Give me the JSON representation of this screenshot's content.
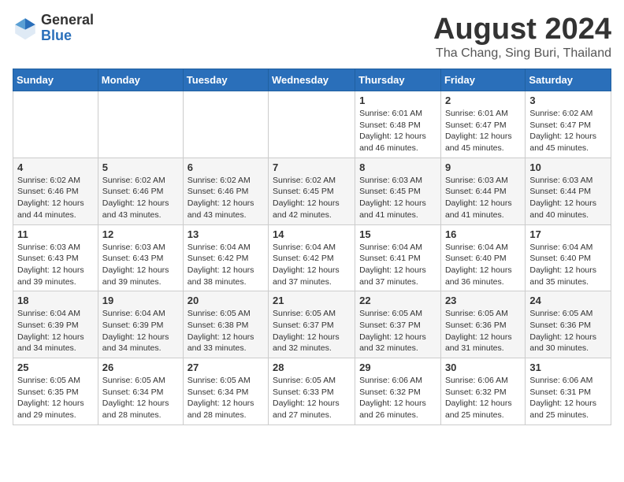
{
  "logo": {
    "general": "General",
    "blue": "Blue"
  },
  "title": "August 2024",
  "location": "Tha Chang, Sing Buri, Thailand",
  "weekdays": [
    "Sunday",
    "Monday",
    "Tuesday",
    "Wednesday",
    "Thursday",
    "Friday",
    "Saturday"
  ],
  "weeks": [
    [
      {
        "day": "",
        "info": ""
      },
      {
        "day": "",
        "info": ""
      },
      {
        "day": "",
        "info": ""
      },
      {
        "day": "",
        "info": ""
      },
      {
        "day": "1",
        "info": "Sunrise: 6:01 AM\nSunset: 6:48 PM\nDaylight: 12 hours\nand 46 minutes."
      },
      {
        "day": "2",
        "info": "Sunrise: 6:01 AM\nSunset: 6:47 PM\nDaylight: 12 hours\nand 45 minutes."
      },
      {
        "day": "3",
        "info": "Sunrise: 6:02 AM\nSunset: 6:47 PM\nDaylight: 12 hours\nand 45 minutes."
      }
    ],
    [
      {
        "day": "4",
        "info": "Sunrise: 6:02 AM\nSunset: 6:46 PM\nDaylight: 12 hours\nand 44 minutes."
      },
      {
        "day": "5",
        "info": "Sunrise: 6:02 AM\nSunset: 6:46 PM\nDaylight: 12 hours\nand 43 minutes."
      },
      {
        "day": "6",
        "info": "Sunrise: 6:02 AM\nSunset: 6:46 PM\nDaylight: 12 hours\nand 43 minutes."
      },
      {
        "day": "7",
        "info": "Sunrise: 6:02 AM\nSunset: 6:45 PM\nDaylight: 12 hours\nand 42 minutes."
      },
      {
        "day": "8",
        "info": "Sunrise: 6:03 AM\nSunset: 6:45 PM\nDaylight: 12 hours\nand 41 minutes."
      },
      {
        "day": "9",
        "info": "Sunrise: 6:03 AM\nSunset: 6:44 PM\nDaylight: 12 hours\nand 41 minutes."
      },
      {
        "day": "10",
        "info": "Sunrise: 6:03 AM\nSunset: 6:44 PM\nDaylight: 12 hours\nand 40 minutes."
      }
    ],
    [
      {
        "day": "11",
        "info": "Sunrise: 6:03 AM\nSunset: 6:43 PM\nDaylight: 12 hours\nand 39 minutes."
      },
      {
        "day": "12",
        "info": "Sunrise: 6:03 AM\nSunset: 6:43 PM\nDaylight: 12 hours\nand 39 minutes."
      },
      {
        "day": "13",
        "info": "Sunrise: 6:04 AM\nSunset: 6:42 PM\nDaylight: 12 hours\nand 38 minutes."
      },
      {
        "day": "14",
        "info": "Sunrise: 6:04 AM\nSunset: 6:42 PM\nDaylight: 12 hours\nand 37 minutes."
      },
      {
        "day": "15",
        "info": "Sunrise: 6:04 AM\nSunset: 6:41 PM\nDaylight: 12 hours\nand 37 minutes."
      },
      {
        "day": "16",
        "info": "Sunrise: 6:04 AM\nSunset: 6:40 PM\nDaylight: 12 hours\nand 36 minutes."
      },
      {
        "day": "17",
        "info": "Sunrise: 6:04 AM\nSunset: 6:40 PM\nDaylight: 12 hours\nand 35 minutes."
      }
    ],
    [
      {
        "day": "18",
        "info": "Sunrise: 6:04 AM\nSunset: 6:39 PM\nDaylight: 12 hours\nand 34 minutes."
      },
      {
        "day": "19",
        "info": "Sunrise: 6:04 AM\nSunset: 6:39 PM\nDaylight: 12 hours\nand 34 minutes."
      },
      {
        "day": "20",
        "info": "Sunrise: 6:05 AM\nSunset: 6:38 PM\nDaylight: 12 hours\nand 33 minutes."
      },
      {
        "day": "21",
        "info": "Sunrise: 6:05 AM\nSunset: 6:37 PM\nDaylight: 12 hours\nand 32 minutes."
      },
      {
        "day": "22",
        "info": "Sunrise: 6:05 AM\nSunset: 6:37 PM\nDaylight: 12 hours\nand 32 minutes."
      },
      {
        "day": "23",
        "info": "Sunrise: 6:05 AM\nSunset: 6:36 PM\nDaylight: 12 hours\nand 31 minutes."
      },
      {
        "day": "24",
        "info": "Sunrise: 6:05 AM\nSunset: 6:36 PM\nDaylight: 12 hours\nand 30 minutes."
      }
    ],
    [
      {
        "day": "25",
        "info": "Sunrise: 6:05 AM\nSunset: 6:35 PM\nDaylight: 12 hours\nand 29 minutes."
      },
      {
        "day": "26",
        "info": "Sunrise: 6:05 AM\nSunset: 6:34 PM\nDaylight: 12 hours\nand 28 minutes."
      },
      {
        "day": "27",
        "info": "Sunrise: 6:05 AM\nSunset: 6:34 PM\nDaylight: 12 hours\nand 28 minutes."
      },
      {
        "day": "28",
        "info": "Sunrise: 6:05 AM\nSunset: 6:33 PM\nDaylight: 12 hours\nand 27 minutes."
      },
      {
        "day": "29",
        "info": "Sunrise: 6:06 AM\nSunset: 6:32 PM\nDaylight: 12 hours\nand 26 minutes."
      },
      {
        "day": "30",
        "info": "Sunrise: 6:06 AM\nSunset: 6:32 PM\nDaylight: 12 hours\nand 25 minutes."
      },
      {
        "day": "31",
        "info": "Sunrise: 6:06 AM\nSunset: 6:31 PM\nDaylight: 12 hours\nand 25 minutes."
      }
    ]
  ]
}
